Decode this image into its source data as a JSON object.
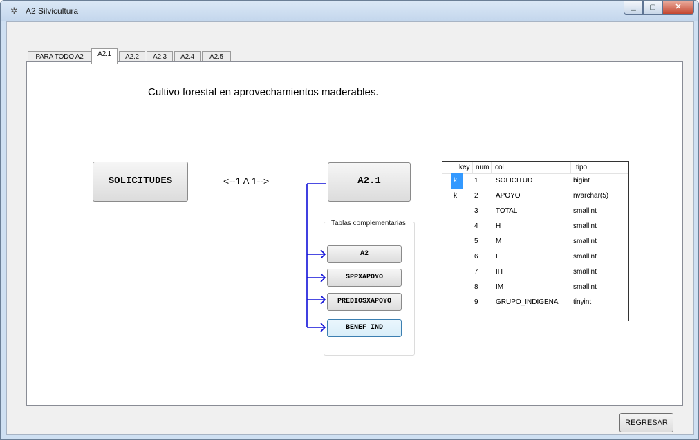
{
  "window": {
    "title": "A2 Silvicultura",
    "minimize_glyph": "▁",
    "maximize_glyph": "▢",
    "close_glyph": "✕",
    "app_icon_glyph": "✲"
  },
  "tabs": [
    {
      "label": "PARA TODO A2",
      "active": false
    },
    {
      "label": "A2.1",
      "active": true
    },
    {
      "label": "A2.2",
      "active": false
    },
    {
      "label": "A2.3",
      "active": false
    },
    {
      "label": "A2.4",
      "active": false
    },
    {
      "label": "A2.5",
      "active": false
    }
  ],
  "panel": {
    "heading": "Cultivo forestal en aprovechamientos maderables.",
    "main_table_button": "SOLICITUDES",
    "relation_label": "<--1 A 1-->",
    "current_table_button": "A2.1",
    "group_label": "Tablas complementarias",
    "complementary_buttons": [
      "A2",
      "SPPXAPOYO",
      "PREDIOSXAPOYO",
      "BENEF_IND"
    ]
  },
  "grid": {
    "columns": [
      "key",
      "num",
      "col",
      "tipo"
    ],
    "rows": [
      {
        "key": "k",
        "num": "1",
        "col": "SOLICITUD",
        "tipo": "bigint"
      },
      {
        "key": "k",
        "num": "2",
        "col": "APOYO",
        "tipo": "nvarchar(5)"
      },
      {
        "key": "",
        "num": "3",
        "col": "TOTAL",
        "tipo": "smallint"
      },
      {
        "key": "",
        "num": "4",
        "col": "H",
        "tipo": "smallint"
      },
      {
        "key": "",
        "num": "5",
        "col": "M",
        "tipo": "smallint"
      },
      {
        "key": "",
        "num": "6",
        "col": "I",
        "tipo": "smallint"
      },
      {
        "key": "",
        "num": "7",
        "col": "IH",
        "tipo": "smallint"
      },
      {
        "key": "",
        "num": "8",
        "col": "IM",
        "tipo": "smallint"
      },
      {
        "key": "",
        "num": "9",
        "col": "GRUPO_INDIGENA",
        "tipo": "tinyint"
      }
    ]
  },
  "footer": {
    "back_button": "REGRESAR"
  },
  "colors": {
    "connector": "#1010d8",
    "selection": "#3399ff"
  }
}
